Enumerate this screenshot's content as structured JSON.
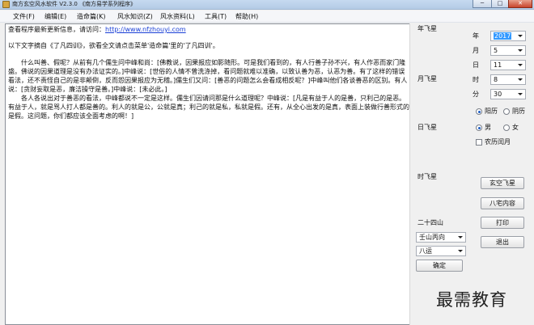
{
  "window": {
    "title": "南方玄空风水软件 V2.3.0    《南方易学系列程序》",
    "minimize": "─",
    "maximize": "□",
    "close": "✕"
  },
  "menu": [
    {
      "label": "文件(F)"
    },
    {
      "label": "编辑(E)"
    },
    {
      "label": "造命篇(K)"
    },
    {
      "label": "风水知识(Z)"
    },
    {
      "label": "风水资料(L)"
    },
    {
      "label": "工具(T)"
    },
    {
      "label": "帮助(H)"
    }
  ],
  "content": {
    "update_prefix": "查看程序最新更新信息，请访问：",
    "update_link": "http://www.nfzhouyi.com",
    "excerpt_note": "以下文字摘自《了凡四训》，欲看全文请点击菜单'造命篇'里的'了凡四训'。",
    "paragraph1": "　　什么叫善、假呢？从前有几个儒生问中峰和尚：[佛教说，因果报应如影随形。可是我们看到的，有人行善子孙不兴，有人作恶而家门隆盛。佛说的因果道理是没有办法证实的。]中峰说：[世俗的人情不曾洗涤掉，看问题就难以准确，以致认善为恶，认恶为善。有了这样的错误看法，还不责怪自己的是非颠倒，反而怨因果报应为无稽。]儒生们又问：[善恶的问题怎么会看成相反呢？]中峰叫他们各谈善恶的区别。有人说：[贪财妄取是恶，廉洁操守是善。]中峰说：[未必此。]",
    "paragraph2": "　　各人各说出对于善恶的看法，中峰都说不一定是这样。儒生们因请问那是什么道理呢？中峰说：[凡是有益于人的是善，只利己的是恶。有益于人，就是骂人打人都是善的。利人的就是公，公就是真；利己的就是私，私就是假。还有，从全心出发的是真，表面上装做行善形式的是假。这问题，你们都应该全面考虑的啊！]"
  },
  "panel": {
    "nian_fei_xing": "年飞星",
    "yue_fei_xing": "月飞星",
    "ri_fei_xing": "日飞星",
    "shi_fei_xing": "时飞星",
    "year_label": "年",
    "year_value": "2017",
    "month_label": "月",
    "month_value": "5",
    "day_label": "日",
    "day_value": "11",
    "hour_label": "时",
    "hour_value": "8",
    "minute_label": "分",
    "minute_value": "30",
    "yang_li": "阳历",
    "yin_li": "阴历",
    "nan": "男",
    "nv": "女",
    "nong_li_run_yue": "农历闰月",
    "btn_xuan_kong": "玄空飞星",
    "btn_ba_zhai": "八宅内容",
    "btn_print": "打印",
    "btn_exit": "退出",
    "er_shi_si_shan": "二十四山",
    "shan_value": "壬山丙向",
    "yun_value": "八运",
    "btn_confirm": "确定"
  },
  "watermark": "最需教育"
}
